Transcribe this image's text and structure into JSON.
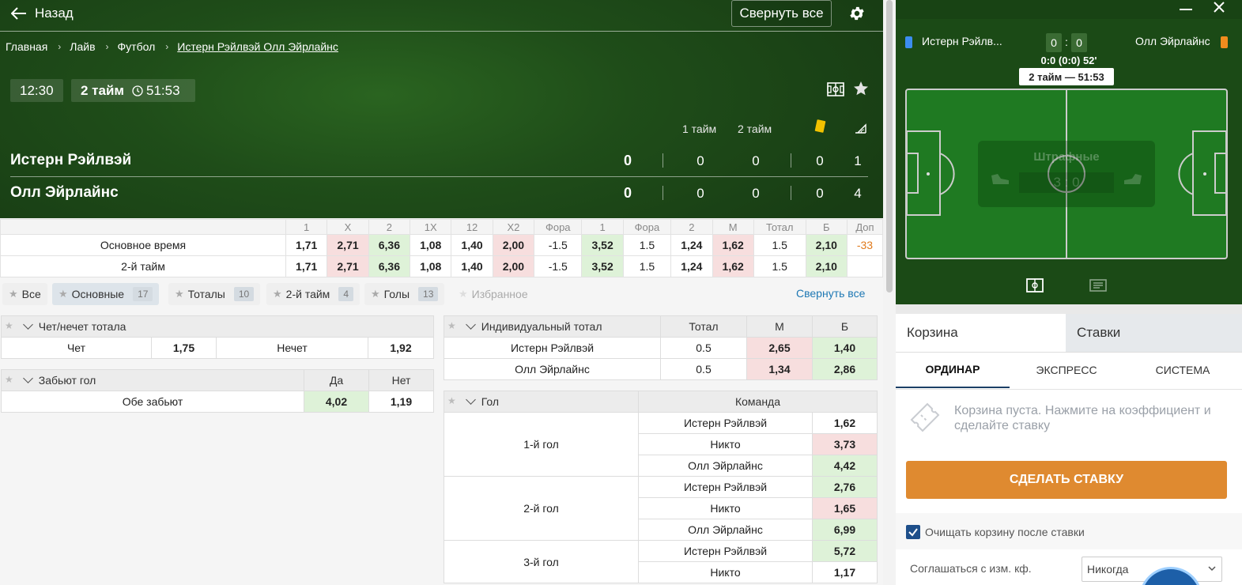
{
  "header": {
    "back_label": "Назад",
    "collapse_label": "Свернуть все"
  },
  "breadcrumbs": [
    "Главная",
    "Лайв",
    "Футбол",
    "Истерн Рэйлвэй Олл Эйрлайнс"
  ],
  "match": {
    "time": "12:30",
    "period": "2 тайм",
    "clock": "51:53",
    "col_h1": "1 тайм",
    "col_h2": "2 тайм",
    "teams": [
      {
        "name": "Истерн Рэйлвэй",
        "total": "0",
        "h1": "0",
        "h2": "0",
        "cards": "0",
        "corners": "1"
      },
      {
        "name": "Олл Эйрлайнс",
        "total": "0",
        "h1": "0",
        "h2": "0",
        "cards": "0",
        "corners": "4"
      }
    ]
  },
  "markets": {
    "headers": [
      "1",
      "X",
      "2",
      "1X",
      "12",
      "X2",
      "Фора",
      "1",
      "Фора",
      "2",
      "М",
      "Тотал",
      "Б",
      "Доп"
    ],
    "rows": [
      {
        "label": "Основное время",
        "cells": [
          "1,71",
          "2,71",
          "6,36",
          "1,08",
          "1,40",
          "2,00",
          "-1.5",
          "3,52",
          "1.5",
          "1,24",
          "1,62",
          "1.5",
          "2,10",
          "-33"
        ]
      },
      {
        "label": "2-й тайм",
        "cells": [
          "1,71",
          "2,71",
          "6,36",
          "1,08",
          "1,40",
          "2,00",
          "-1.5",
          "3,52",
          "1.5",
          "1,24",
          "1,62",
          "1.5",
          "2,10",
          ""
        ]
      }
    ]
  },
  "filters": [
    {
      "label": "Все",
      "count": ""
    },
    {
      "label": "Основные",
      "count": "17"
    },
    {
      "label": "Тоталы",
      "count": "10"
    },
    {
      "label": "2-й тайм",
      "count": "4"
    },
    {
      "label": "Голы",
      "count": "13"
    },
    {
      "label": "Избранное",
      "count": ""
    }
  ],
  "collapse_all": "Свернуть все",
  "odd_even": {
    "title": "Чет/нечет тотала",
    "even": "Чет",
    "even_odd": "1,75",
    "odd": "Нечет",
    "odd_odd": "1,92"
  },
  "both_score": {
    "title": "Забьют гол",
    "yes": "Да",
    "no": "Нет",
    "label": "Обе забьют",
    "yes_odd": "4,02",
    "no_odd": "1,19"
  },
  "ind_total": {
    "title": "Индивидуальный тотал",
    "h_total": "Тотал",
    "h_m": "М",
    "h_b": "Б",
    "rows": [
      {
        "team": "Истерн Рэйлвэй",
        "total": "0.5",
        "m": "2,65",
        "b": "1,40"
      },
      {
        "team": "Олл Эйрлайнс",
        "total": "0.5",
        "m": "1,34",
        "b": "2,86"
      }
    ]
  },
  "goal": {
    "title": "Гол",
    "team_h": "Команда",
    "groups": [
      {
        "label": "1-й гол",
        "rows": [
          {
            "t": "Истерн Рэйлвэй",
            "o": "1,62"
          },
          {
            "t": "Никто",
            "o": "3,73"
          },
          {
            "t": "Олл Эйрлайнс",
            "o": "4,42"
          }
        ]
      },
      {
        "label": "2-й гол",
        "rows": [
          {
            "t": "Истерн Рэйлвэй",
            "o": "2,76"
          },
          {
            "t": "Никто",
            "o": "1,65"
          },
          {
            "t": "Олл Эйрлайнс",
            "o": "6,99"
          }
        ]
      },
      {
        "label": "3-й гол",
        "rows": [
          {
            "t": "Истерн Рэйлвэй",
            "o": "5,72"
          },
          {
            "t": "Никто",
            "o": "1,17"
          }
        ]
      }
    ]
  },
  "side": {
    "home": "Истерн Рэйлв...",
    "away": "Олл Эйрлайнс",
    "home_score": "0",
    "away_score": "0",
    "sep": ":",
    "status": "0:0 (0:0) 52'",
    "halftime": "2 тайм — 51:53",
    "overlay_title": "Штрафные",
    "overlay_score": "3 : 0"
  },
  "basket": {
    "tab_basket": "Корзина",
    "tab_bets": "Ставки",
    "sub": [
      "ОРДИНАР",
      "ЭКСПРЕСС",
      "СИСТЕМА"
    ],
    "empty_msg": "Корзина пуста. Нажмите на коэффициент и сделайте ставку",
    "bet_button": "СДЕЛАТЬ СТАВКУ",
    "clear_label": "Очищать корзину после ставки",
    "agree_label": "Соглашаться с изм. кф.",
    "agree_value": "Никогда"
  },
  "colors": {
    "accent": "#df8a30",
    "link": "#1e78b4",
    "odd_red": "#f7dede",
    "odd_green": "#def2d8",
    "hero_green": "#1f4d19"
  }
}
